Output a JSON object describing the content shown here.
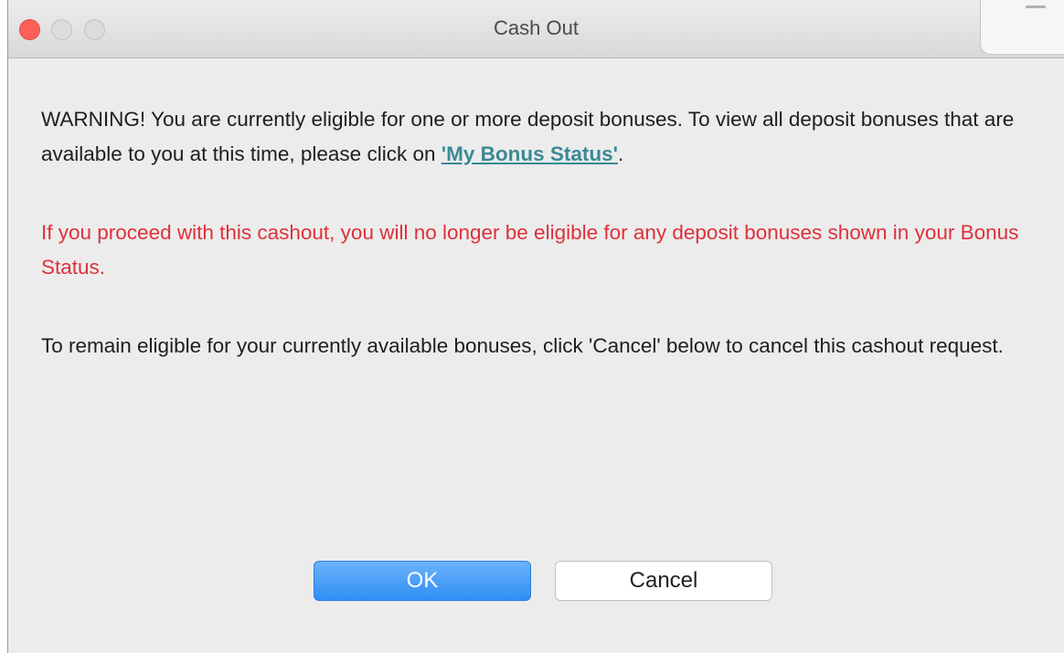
{
  "window": {
    "title": "Cash Out"
  },
  "message": {
    "warning_text": "WARNING! You are currently eligible for one or more deposit bonuses. To view all deposit bonuses that are available to you at this time, please click on ",
    "bonus_link": "'My Bonus Status'",
    "warning_end": ".",
    "red_warning": "If you proceed with this cashout, you will no longer be eligible for any deposit bonuses shown in your Bonus Status.",
    "cancel_instruction": "To remain eligible for your currently available bonuses, click 'Cancel' below to cancel this cashout request."
  },
  "buttons": {
    "ok_label": "OK",
    "cancel_label": "Cancel"
  },
  "colors": {
    "link": "#3a8a94",
    "warning_red": "#e0303a",
    "ok_button": "#2f8ef5",
    "close_button": "#fc605b"
  }
}
